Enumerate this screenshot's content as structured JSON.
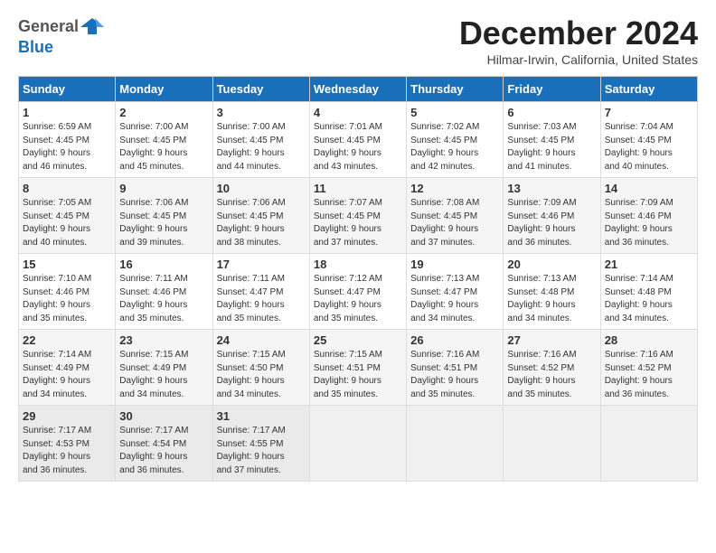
{
  "logo": {
    "line1": "General",
    "line2": "Blue"
  },
  "title": "December 2024",
  "location": "Hilmar-Irwin, California, United States",
  "days_header": [
    "Sunday",
    "Monday",
    "Tuesday",
    "Wednesday",
    "Thursday",
    "Friday",
    "Saturday"
  ],
  "weeks": [
    [
      {
        "day": "1",
        "content": "Sunrise: 6:59 AM\nSunset: 4:45 PM\nDaylight: 9 hours\nand 46 minutes."
      },
      {
        "day": "2",
        "content": "Sunrise: 7:00 AM\nSunset: 4:45 PM\nDaylight: 9 hours\nand 45 minutes."
      },
      {
        "day": "3",
        "content": "Sunrise: 7:00 AM\nSunset: 4:45 PM\nDaylight: 9 hours\nand 44 minutes."
      },
      {
        "day": "4",
        "content": "Sunrise: 7:01 AM\nSunset: 4:45 PM\nDaylight: 9 hours\nand 43 minutes."
      },
      {
        "day": "5",
        "content": "Sunrise: 7:02 AM\nSunset: 4:45 PM\nDaylight: 9 hours\nand 42 minutes."
      },
      {
        "day": "6",
        "content": "Sunrise: 7:03 AM\nSunset: 4:45 PM\nDaylight: 9 hours\nand 41 minutes."
      },
      {
        "day": "7",
        "content": "Sunrise: 7:04 AM\nSunset: 4:45 PM\nDaylight: 9 hours\nand 40 minutes."
      }
    ],
    [
      {
        "day": "8",
        "content": "Sunrise: 7:05 AM\nSunset: 4:45 PM\nDaylight: 9 hours\nand 40 minutes."
      },
      {
        "day": "9",
        "content": "Sunrise: 7:06 AM\nSunset: 4:45 PM\nDaylight: 9 hours\nand 39 minutes."
      },
      {
        "day": "10",
        "content": "Sunrise: 7:06 AM\nSunset: 4:45 PM\nDaylight: 9 hours\nand 38 minutes."
      },
      {
        "day": "11",
        "content": "Sunrise: 7:07 AM\nSunset: 4:45 PM\nDaylight: 9 hours\nand 37 minutes."
      },
      {
        "day": "12",
        "content": "Sunrise: 7:08 AM\nSunset: 4:45 PM\nDaylight: 9 hours\nand 37 minutes."
      },
      {
        "day": "13",
        "content": "Sunrise: 7:09 AM\nSunset: 4:46 PM\nDaylight: 9 hours\nand 36 minutes."
      },
      {
        "day": "14",
        "content": "Sunrise: 7:09 AM\nSunset: 4:46 PM\nDaylight: 9 hours\nand 36 minutes."
      }
    ],
    [
      {
        "day": "15",
        "content": "Sunrise: 7:10 AM\nSunset: 4:46 PM\nDaylight: 9 hours\nand 35 minutes."
      },
      {
        "day": "16",
        "content": "Sunrise: 7:11 AM\nSunset: 4:46 PM\nDaylight: 9 hours\nand 35 minutes."
      },
      {
        "day": "17",
        "content": "Sunrise: 7:11 AM\nSunset: 4:47 PM\nDaylight: 9 hours\nand 35 minutes."
      },
      {
        "day": "18",
        "content": "Sunrise: 7:12 AM\nSunset: 4:47 PM\nDaylight: 9 hours\nand 35 minutes."
      },
      {
        "day": "19",
        "content": "Sunrise: 7:13 AM\nSunset: 4:47 PM\nDaylight: 9 hours\nand 34 minutes."
      },
      {
        "day": "20",
        "content": "Sunrise: 7:13 AM\nSunset: 4:48 PM\nDaylight: 9 hours\nand 34 minutes."
      },
      {
        "day": "21",
        "content": "Sunrise: 7:14 AM\nSunset: 4:48 PM\nDaylight: 9 hours\nand 34 minutes."
      }
    ],
    [
      {
        "day": "22",
        "content": "Sunrise: 7:14 AM\nSunset: 4:49 PM\nDaylight: 9 hours\nand 34 minutes."
      },
      {
        "day": "23",
        "content": "Sunrise: 7:15 AM\nSunset: 4:49 PM\nDaylight: 9 hours\nand 34 minutes."
      },
      {
        "day": "24",
        "content": "Sunrise: 7:15 AM\nSunset: 4:50 PM\nDaylight: 9 hours\nand 34 minutes."
      },
      {
        "day": "25",
        "content": "Sunrise: 7:15 AM\nSunset: 4:51 PM\nDaylight: 9 hours\nand 35 minutes."
      },
      {
        "day": "26",
        "content": "Sunrise: 7:16 AM\nSunset: 4:51 PM\nDaylight: 9 hours\nand 35 minutes."
      },
      {
        "day": "27",
        "content": "Sunrise: 7:16 AM\nSunset: 4:52 PM\nDaylight: 9 hours\nand 35 minutes."
      },
      {
        "day": "28",
        "content": "Sunrise: 7:16 AM\nSunset: 4:52 PM\nDaylight: 9 hours\nand 36 minutes."
      }
    ],
    [
      {
        "day": "29",
        "content": "Sunrise: 7:17 AM\nSunset: 4:53 PM\nDaylight: 9 hours\nand 36 minutes."
      },
      {
        "day": "30",
        "content": "Sunrise: 7:17 AM\nSunset: 4:54 PM\nDaylight: 9 hours\nand 36 minutes."
      },
      {
        "day": "31",
        "content": "Sunrise: 7:17 AM\nSunset: 4:55 PM\nDaylight: 9 hours\nand 37 minutes."
      },
      {
        "day": "",
        "content": ""
      },
      {
        "day": "",
        "content": ""
      },
      {
        "day": "",
        "content": ""
      },
      {
        "day": "",
        "content": ""
      }
    ]
  ]
}
